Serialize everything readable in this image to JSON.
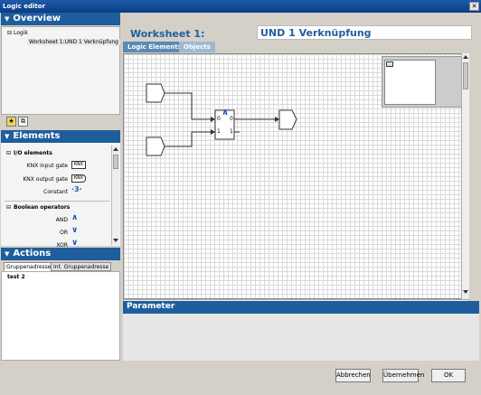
{
  "window": {
    "title": "Logic editor",
    "close_icon": "close-icon"
  },
  "overview": {
    "header": "Overview",
    "tree": {
      "root": "Logik",
      "child": "Worksheet 1:UND 1 Verknüpfung"
    }
  },
  "toolbar": {
    "star_icon": "star-icon",
    "delete_icon": "trash-icon"
  },
  "elements": {
    "header": "Elements",
    "groups": [
      {
        "title": "I/O elements",
        "items": [
          {
            "label": "KNX input gate",
            "symbol": "KNX"
          },
          {
            "label": "KNX output gate",
            "symbol": "KNX"
          },
          {
            "label": "Constant",
            "symbol": "·3·"
          }
        ]
      },
      {
        "title": "Boolean operators",
        "items": [
          {
            "label": "AND",
            "symbol": "∧"
          },
          {
            "label": "OR",
            "symbol": "∨"
          },
          {
            "label": "XOR",
            "symbol": "∨"
          }
        ]
      }
    ]
  },
  "actions": {
    "header": "Actions",
    "tabs": [
      "Gruppenadresse",
      "Int. Gruppenadresse"
    ],
    "active_tab": 0,
    "items": [
      "test 2"
    ]
  },
  "worksheet": {
    "label": "Worksheet 1:",
    "name": "UND 1 Verknüpfung",
    "tabs": [
      "Logic Elements",
      "Objects"
    ],
    "active_tab": 0,
    "gate": {
      "in0": "0",
      "in1": "1",
      "out0": "0",
      "out1": "1",
      "symbol": "∧"
    }
  },
  "parameter": {
    "header": "Parameter"
  },
  "buttons": {
    "cancel": "Abbrechen",
    "apply": "Übernehmen",
    "ok": "OK"
  },
  "colors": {
    "accent": "#1f5e9c",
    "tab_active": "#5a8ab5",
    "tab_inactive": "#9fb9d3",
    "background": "#d4d0c8"
  }
}
